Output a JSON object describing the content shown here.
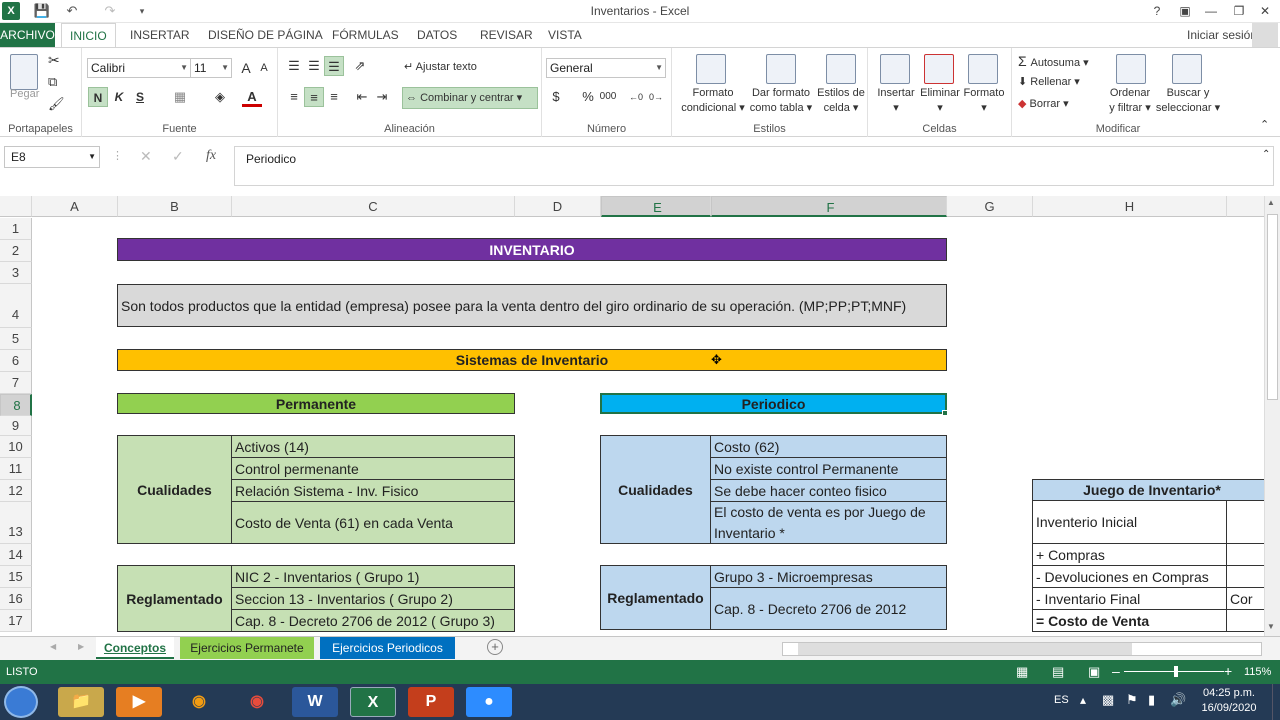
{
  "window": {
    "title": "Inventarios - Excel"
  },
  "ribbon_tabs": [
    "ARCHIVO",
    "INICIO",
    "INSERTAR",
    "DISEÑO DE PÁGINA",
    "FÓRMULAS",
    "DATOS",
    "REVISAR",
    "VISTA"
  ],
  "signin": "Iniciar sesión",
  "clipboard": {
    "paste": "Pegar",
    "label": "Portapapeles"
  },
  "font": {
    "name": "Calibri",
    "size": "11",
    "bold": "N",
    "italic": "K",
    "underline": "S",
    "label": "Fuente"
  },
  "alignment": {
    "wrap": "Ajustar texto",
    "merge": "Combinar y centrar",
    "label": "Alineación"
  },
  "number": {
    "format": "General",
    "currency": "$",
    "percent": "%",
    "thousands": "000",
    "label": "Número"
  },
  "styles": {
    "cond1": "Formato",
    "cond2": "condicional",
    "table1": "Dar formato",
    "table2": "como tabla",
    "cell1": "Estilos de",
    "cell2": "celda",
    "label": "Estilos"
  },
  "cells": {
    "insert": "Insertar",
    "delete": "Eliminar",
    "format": "Formato",
    "label": "Celdas"
  },
  "editing": {
    "autosum": "Autosuma",
    "fill": "Rellenar",
    "clear": "Borrar",
    "sort1": "Ordenar",
    "sort2": "y filtrar",
    "find1": "Buscar y",
    "find2": "seleccionar",
    "label": "Modificar"
  },
  "formula_bar": {
    "name_box": "E8",
    "fx": "fx",
    "content": "Periodico"
  },
  "columns": [
    "A",
    "B",
    "C",
    "D",
    "E",
    "F",
    "G",
    "H"
  ],
  "rows": [
    "1",
    "2",
    "3",
    "4",
    "5",
    "6",
    "7",
    "8",
    "9",
    "10",
    "11",
    "12",
    "13",
    "14",
    "15",
    "16",
    "17"
  ],
  "sheet": {
    "title": "INVENTARIO",
    "definition": "Son todos productos que la entidad (empresa) posee para la venta dentro del giro ordinario de su operación. (MP;PP;PT;MNF)",
    "systems": "Sistemas de Inventario",
    "permanent": {
      "header": "Permanente",
      "qualities_label": "Cualidades",
      "qualities": [
        "Activos (14)",
        "Control permenante",
        "Relación Sistema - Inv. Fisico",
        "Costo de Venta (61) en cada Venta"
      ],
      "regulated_label": "Reglamentado",
      "regulated": [
        "NIC 2 - Inventarios ( Grupo 1)",
        "Seccion 13 - Inventarios ( Grupo 2)",
        "Cap. 8 - Decreto 2706 de 2012 ( Grupo 3)"
      ]
    },
    "periodic": {
      "header": "Periodico",
      "qualities_label": "Cualidades",
      "qualities": [
        "Costo (62)",
        "No existe control Permanente",
        "Se debe hacer conteo fisico",
        "El costo de venta es por Juego de Inventario *"
      ],
      "regulated_label": "Reglamentado",
      "regulated": [
        "Grupo 3 - Microempresas",
        "Cap. 8 - Decreto 2706 de 2012"
      ]
    },
    "game": {
      "header": "Juego de Inventario*",
      "items": [
        "Inventerio Inicial",
        " + Compras",
        " - Devoluciones en Compras",
        " - Inventario Final",
        "= Costo de Venta"
      ],
      "partial": "Cor"
    }
  },
  "sheet_tabs": [
    "Conceptos",
    "Ejercicios Permanete",
    "Ejercicios Periodicos"
  ],
  "status": {
    "mode": "LISTO",
    "zoom": "115%"
  },
  "taskbar": {
    "lang": "ES",
    "time": "04:25 p.m.",
    "date": "16/09/2020"
  }
}
